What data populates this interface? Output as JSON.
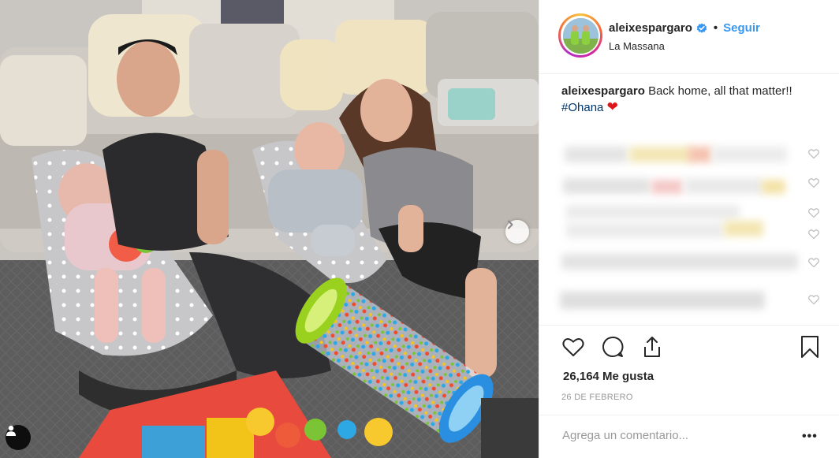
{
  "post": {
    "username": "aleixespargaro",
    "follow_label": "Seguir",
    "separator": "•",
    "location": "La Massana",
    "caption": {
      "user": "aleixespargaro",
      "text": "Back home, all that matter!!",
      "hashtag": "#Ohana",
      "emoji": "❤"
    },
    "likes_label": "26,164 Me gusta",
    "date_label": "26 DE FEBRERO",
    "comment_placeholder": "Agrega un comentario...",
    "more_label": "•••"
  },
  "icons": {
    "verified": "verified-badge-icon",
    "like": "heart-icon",
    "comment": "comment-bubble-icon",
    "share": "share-icon",
    "save": "bookmark-icon",
    "next": "chevron-right-icon",
    "user_tag": "user-tag-icon"
  },
  "colors": {
    "link_blue": "#3897f0",
    "hashtag_blue": "#003569",
    "heart_red": "#e0161d",
    "meta_gray": "#999999",
    "border": "#efefef"
  }
}
